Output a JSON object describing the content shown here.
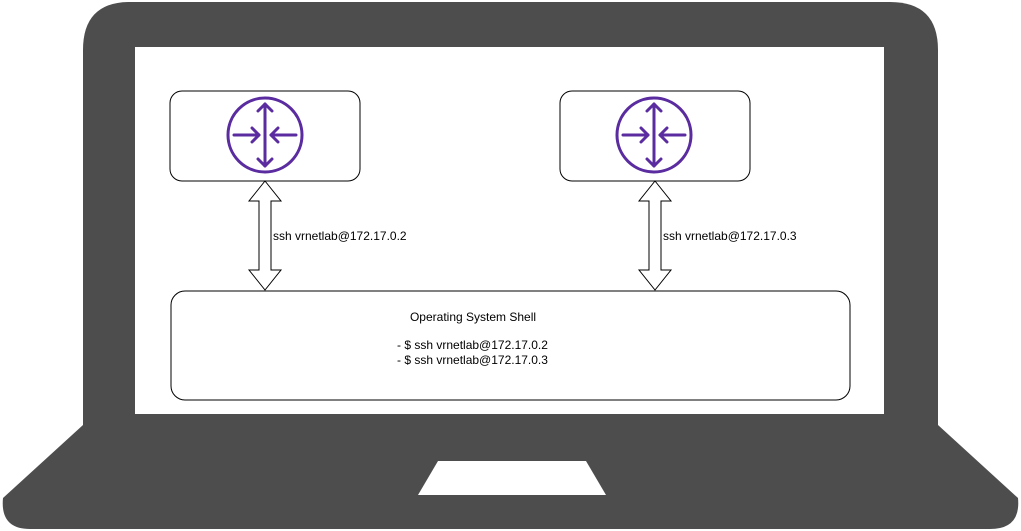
{
  "colors": {
    "laptop_body": "#4d4d4d",
    "screen": "#ffffff",
    "router_accent": "#5a2ca0",
    "outline": "#000000"
  },
  "routers": [
    {
      "icon": "router-icon",
      "link_label": "ssh vrnetlab@172.17.0.2"
    },
    {
      "icon": "router-icon",
      "link_label": "ssh vrnetlab@172.17.0.3"
    }
  ],
  "shell": {
    "title": "Operating System Shell",
    "lines": [
      "- $ ssh vrnetlab@172.17.0.2",
      "- $ ssh vrnetlab@172.17.0.3"
    ]
  }
}
